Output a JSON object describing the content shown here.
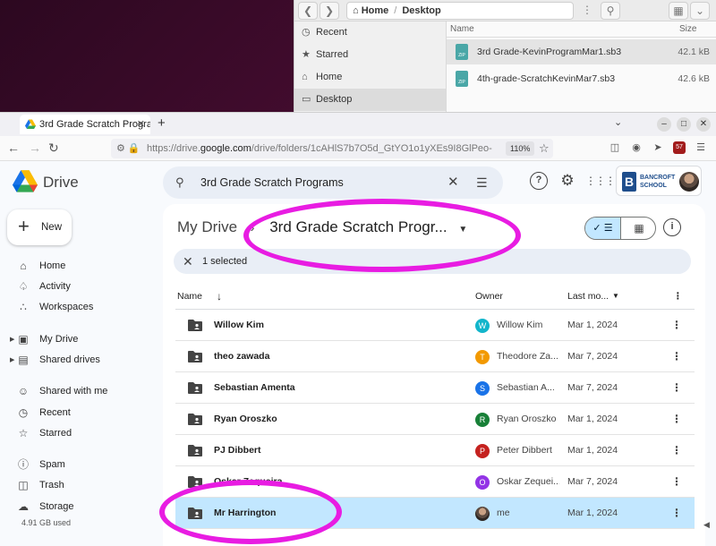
{
  "file_manager": {
    "path_home": "Home",
    "path_sep": "/",
    "path_current": "Desktop",
    "sidebar": [
      {
        "icon": "clock-icon",
        "label": "Recent"
      },
      {
        "icon": "star-icon",
        "label": "Starred"
      },
      {
        "icon": "home-icon",
        "label": "Home"
      },
      {
        "icon": "desktop-icon",
        "label": "Desktop"
      }
    ],
    "col_name": "Name",
    "col_size": "Size",
    "files": [
      {
        "name": "3rd Grade-KevinProgramMar1.sb3",
        "size": "42.1 kB"
      },
      {
        "name": "4th-grade-ScratchKevinMar7.sb3",
        "size": "42.6 kB"
      }
    ],
    "zip_label": "ZIP"
  },
  "browser": {
    "tab_title": "3rd Grade Scratch Progra",
    "url_prefix": "https://drive.",
    "url_host": "google.com",
    "url_rest": "/drive/folders/1cAHlS7b7O5d_GtYO1o1yXEs9I8GlPeo-",
    "zoom": "110%",
    "ext_badge": "57"
  },
  "drive": {
    "app_name": "Drive",
    "search_value": "3rd Grade Scratch Programs",
    "account_org": "BANCROFT",
    "account_org_sub": "SCHOOL",
    "new_label": "New",
    "nav": [
      {
        "icon": "home-icon",
        "label": "Home"
      },
      {
        "icon": "bell-icon",
        "label": "Activity"
      },
      {
        "icon": "workspaces-icon",
        "label": "Workspaces"
      },
      {
        "icon": "my-drive-icon",
        "label": "My Drive",
        "caret": true
      },
      {
        "icon": "shared-drives-icon",
        "label": "Shared drives",
        "caret": true
      },
      {
        "icon": "people-icon",
        "label": "Shared with me"
      },
      {
        "icon": "clock-icon",
        "label": "Recent"
      },
      {
        "icon": "star-icon",
        "label": "Starred"
      },
      {
        "icon": "spam-icon",
        "label": "Spam"
      },
      {
        "icon": "trash-icon",
        "label": "Trash"
      },
      {
        "icon": "cloud-icon",
        "label": "Storage"
      }
    ],
    "storage_used": "4.91 GB used",
    "breadcrumb_root": "My Drive",
    "breadcrumb_current": "3rd Grade Scratch Progr...",
    "selection_text": "1 selected",
    "columns": {
      "name": "Name",
      "owner": "Owner",
      "last_modified": "Last mo..."
    },
    "rows": [
      {
        "name": "Willow Kim",
        "owner_initial": "W",
        "owner": "Willow Kim",
        "owner_color": "#12b5cb",
        "date": "Mar 1, 2024"
      },
      {
        "name": "theo zawada",
        "owner_initial": "T",
        "owner": "Theodore Za...",
        "owner_color": "#f29900",
        "date": "Mar 7, 2024"
      },
      {
        "name": "Sebastian Amenta",
        "owner_initial": "S",
        "owner": "Sebastian A...",
        "owner_color": "#1a73e8",
        "date": "Mar 7, 2024"
      },
      {
        "name": "Ryan Oroszko",
        "owner_initial": "R",
        "owner": "Ryan Oroszko",
        "owner_color": "#188038",
        "date": "Mar 1, 2024"
      },
      {
        "name": "PJ Dibbert",
        "owner_initial": "P",
        "owner": "Peter Dibbert",
        "owner_color": "#c5221f",
        "date": "Mar 1, 2024"
      },
      {
        "name": "Oskar Zequeira",
        "owner_initial": "O",
        "owner": "Oskar Zequei...",
        "owner_color": "#9334e6",
        "date": "Mar 7, 2024"
      },
      {
        "name": "Mr Harrington",
        "owner_initial": "",
        "owner": "me",
        "owner_color": "#5b4a40",
        "date": "Mar 1, 2024",
        "selected": true
      }
    ]
  },
  "colors": {
    "annotation": "#e81ce2",
    "selected_row": "#c2e7ff",
    "search_bg": "#e9eef6"
  }
}
